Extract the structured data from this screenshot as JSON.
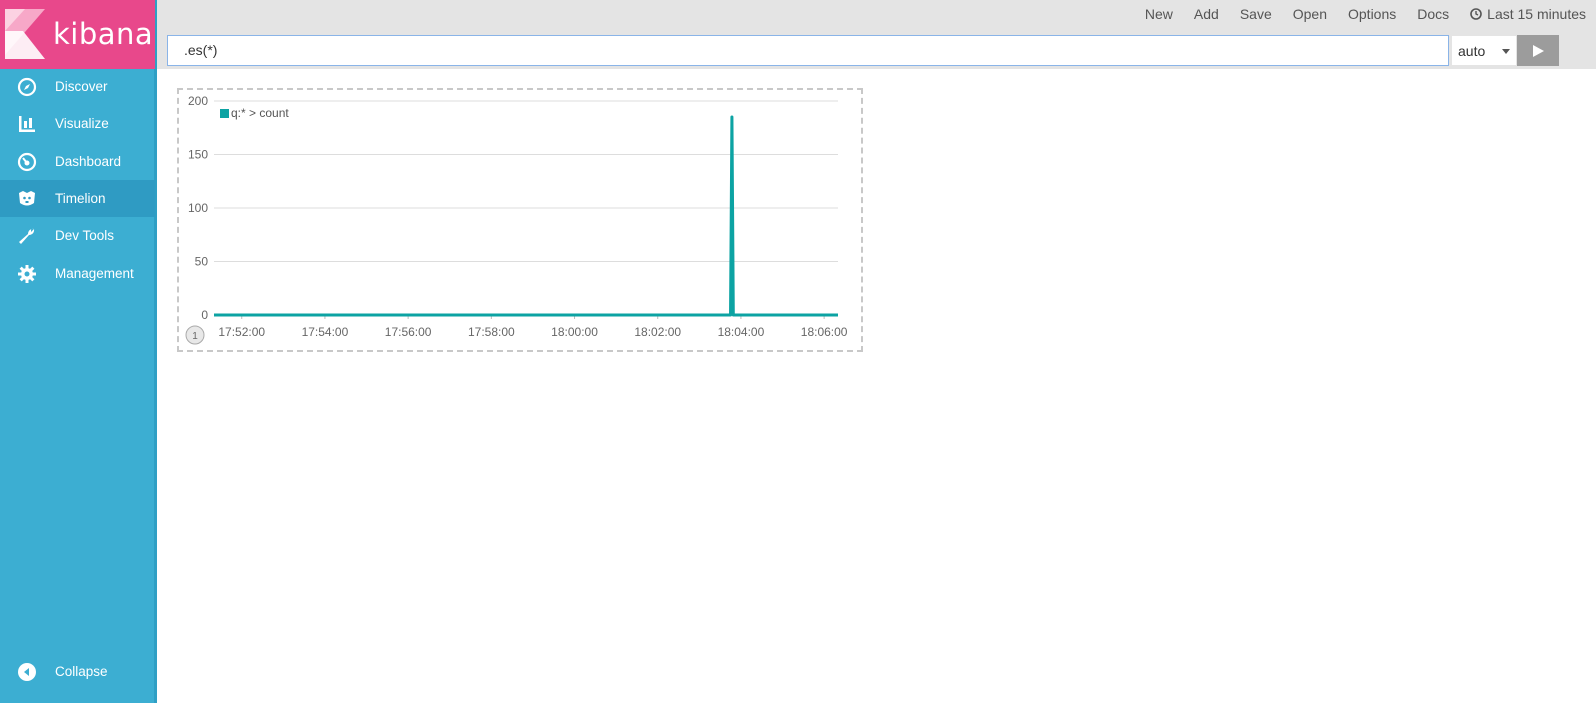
{
  "app": {
    "brand": "kibana",
    "brand_color": "#e8488b",
    "sidebar_color": "#3caed2"
  },
  "sidebar": {
    "items": [
      {
        "label": "Discover",
        "icon": "compass-icon"
      },
      {
        "label": "Visualize",
        "icon": "bar-chart-icon"
      },
      {
        "label": "Dashboard",
        "icon": "gauge-icon"
      },
      {
        "label": "Timelion",
        "icon": "timelion-icon",
        "active": true
      },
      {
        "label": "Dev Tools",
        "icon": "wrench-icon"
      },
      {
        "label": "Management",
        "icon": "gear-icon"
      }
    ],
    "collapse_label": "Collapse"
  },
  "toolbar": {
    "new_label": "New",
    "add_label": "Add",
    "save_label": "Save",
    "open_label": "Open",
    "options_label": "Options",
    "docs_label": "Docs",
    "time_range": "Last 15 minutes"
  },
  "query": {
    "expression": ".es(*)",
    "interval": "auto"
  },
  "chart_data": {
    "type": "line",
    "series": [
      {
        "name": "q:* > count",
        "color": "#0ca3a3",
        "points": [
          [
            "17:52:00",
            0
          ],
          [
            "18:03:45",
            0
          ],
          [
            "18:03:47",
            185
          ],
          [
            "18:03:49",
            0
          ],
          [
            "18:06:20",
            0
          ]
        ]
      }
    ],
    "x_tick_labels": [
      "17:52:00",
      "17:54:00",
      "17:56:00",
      "17:58:00",
      "18:00:00",
      "18:02:00",
      "18:04:00",
      "18:06:00"
    ],
    "y_tick_labels": [
      "0",
      "50",
      "100",
      "150",
      "200"
    ],
    "ylim": [
      0,
      200
    ],
    "grid": true,
    "legend": "top-left",
    "panel_index": "1"
  }
}
